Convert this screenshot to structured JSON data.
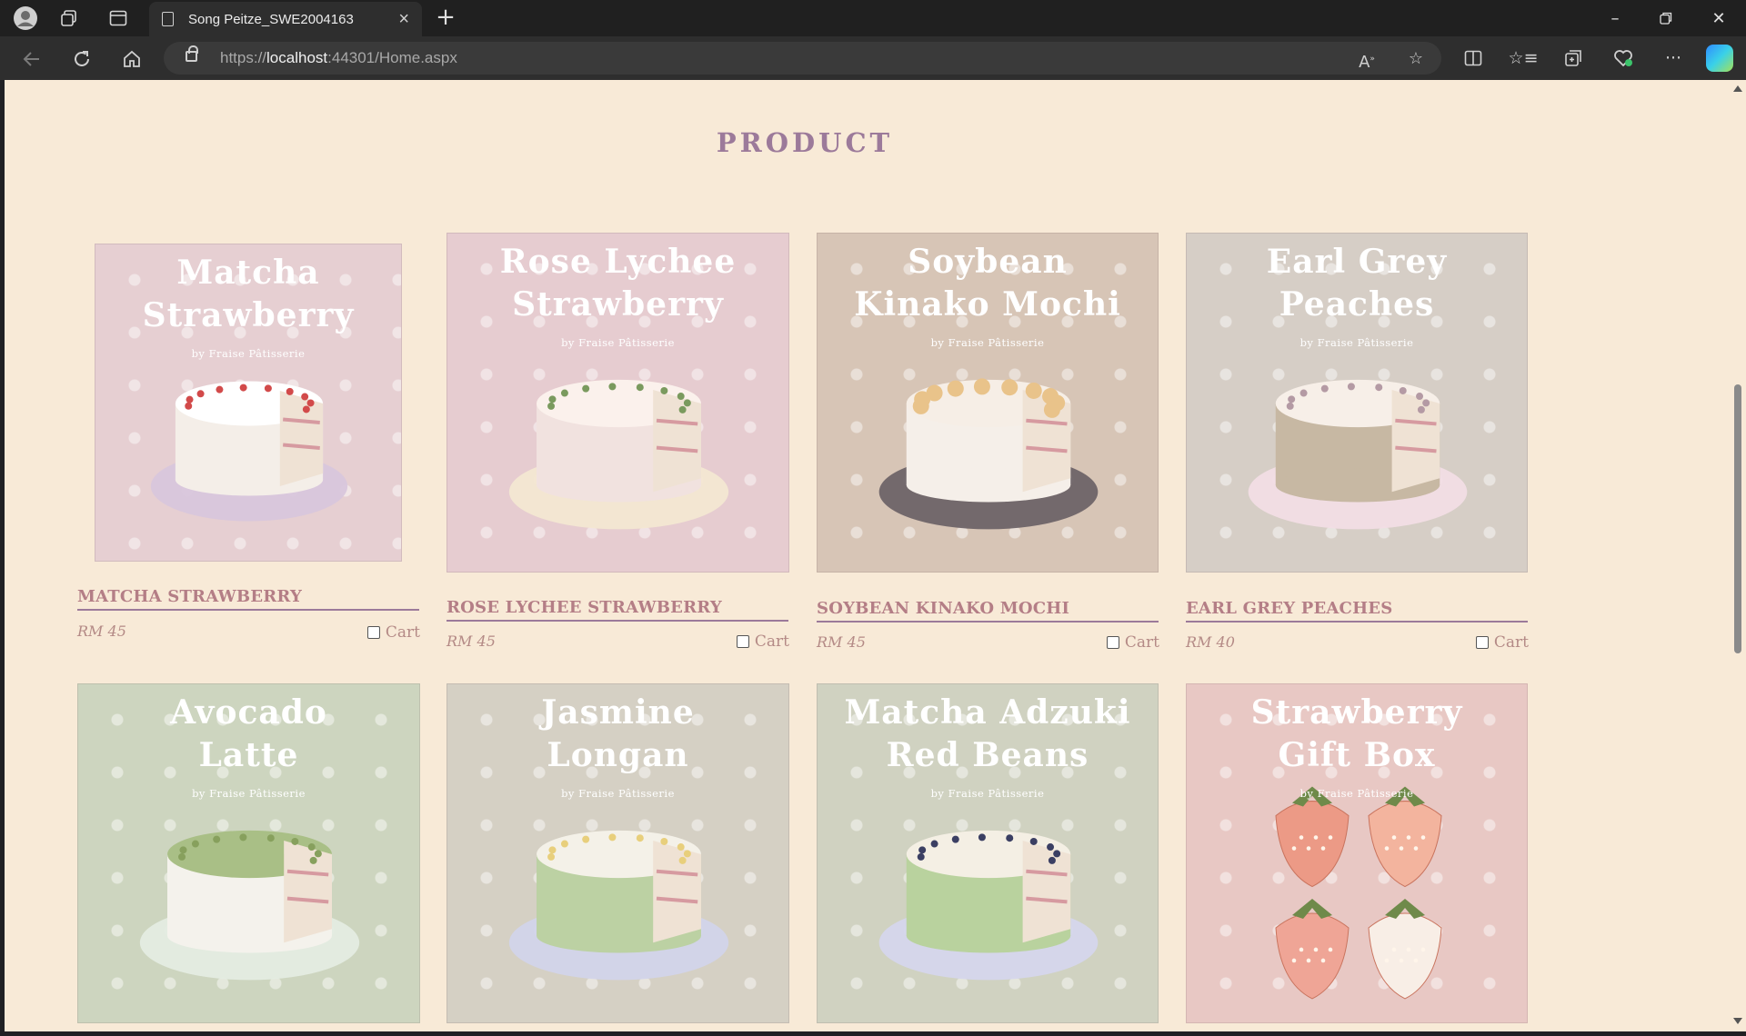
{
  "browser": {
    "tab_title": "Song Peitze_SWE2004163",
    "url_prefix": "https://",
    "url_host": "localhost",
    "url_rest": ":44301/Home.aspx"
  },
  "page": {
    "section_title": "PRODUCT",
    "brand_text": "by Fraise Pâtisserie",
    "cart_label": "Cart"
  },
  "products": [
    {
      "image_title_1": "Matcha",
      "image_title_2": "Strawberry",
      "name": "MATCHA STRAWBERRY",
      "price": "RM 45",
      "bg": "#e6cfd2",
      "plate": "#d8c6dc",
      "icing": "#ffffff",
      "side": "#f4eee8",
      "topping": "#d24a4a"
    },
    {
      "image_title_1": "Rose Lychee",
      "image_title_2": "Strawberry",
      "name": "ROSE LYCHEE STRAWBERRY",
      "price": "RM 45",
      "bg": "#e6ccd0",
      "plate": "#f3e7d2",
      "icing": "#fbf1ec",
      "side": "#f1e2df",
      "topping": "#7a9a5e"
    },
    {
      "image_title_1": "Soybean",
      "image_title_2": "Kinako Mochi",
      "name": "SOYBEAN KINAKO MOCHI",
      "price": "RM 45",
      "bg": "#d7c5b6",
      "plate": "#6e6468",
      "icing": "#f6eee6",
      "side": "#f5efe9",
      "topping": "#e9c38a"
    },
    {
      "image_title_1": "Earl Grey",
      "image_title_2": "Peaches",
      "name": "EARL GREY PEACHES",
      "price": "RM 40",
      "bg": "#d6cec6",
      "plate": "#f2dde5",
      "icing": "#f7efe8",
      "side": "#c7b8a3",
      "topping": "#b49aa4"
    },
    {
      "image_title_1": "Avocado",
      "image_title_2": "Latte",
      "name": "",
      "price": "",
      "bg": "#cdd5bf",
      "plate": "#e4ece2",
      "icing": "#a9bf86",
      "side": "#f4f2ec",
      "topping": "#87a05d"
    },
    {
      "image_title_1": "Jasmine",
      "image_title_2": "Longan",
      "name": "",
      "price": "",
      "bg": "#d5d0c4",
      "plate": "#d2d4ea",
      "icing": "#f4f1e8",
      "side": "#bcd1a3",
      "topping": "#e8cf7c"
    },
    {
      "image_title_1": "Matcha Adzuki",
      "image_title_2": "Red Beans",
      "name": "",
      "price": "",
      "bg": "#d0d2c1",
      "plate": "#d5d6ec",
      "icing": "#f4efe4",
      "side": "#b9d29e",
      "topping": "#3b3f63"
    },
    {
      "image_title_1": "Strawberry",
      "image_title_2": "Gift Box",
      "name": "",
      "price": "",
      "bg": "#e8c8c4",
      "plate": "",
      "icing": "",
      "side": "",
      "topping": "#e88d7a"
    }
  ]
}
